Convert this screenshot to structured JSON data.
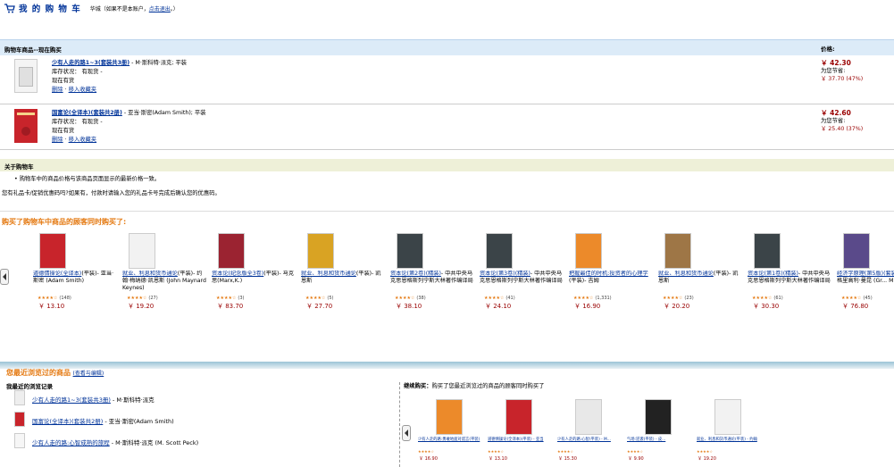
{
  "header": {
    "title": "我 的 购 物 车",
    "subtitle_pre": "华城（如果不是本账户，",
    "subtitle_link": "点击退出",
    "subtitle_post": "。）"
  },
  "cart": {
    "heading": "购物车商品--现在购买",
    "price_heading": "价格:",
    "items": [
      {
        "title": "少有人走的路1~3(套装共3册)",
        "author": " - M·斯科特·派克; 平装",
        "stock_label": "库存状况：",
        "stock_value": "有现货 -",
        "gift": "现在有货",
        "delete": "删除",
        "save": "移入收藏夹",
        "price": "￥ 42.30",
        "save_label": "为您节省:",
        "save_value": "￥ 37.70 (47%)"
      },
      {
        "title": "国富论(全译本)(套装共2册)",
        "author": " - 亚当·斯密(Adam Smith); 平装",
        "stock_label": "库存状况：",
        "stock_value": "有现货 -",
        "gift": "现在有货",
        "delete": "删除",
        "save": "移入收藏夹",
        "price": "￥ 42.60",
        "save_label": "为您节省:",
        "save_value": "￥ 25.40 (37%)"
      }
    ]
  },
  "about": {
    "heading": "关于购物车",
    "line1": "• 购物车中的商品价格与该商品页面显示的最新价格一致。",
    "line2": "您有礼品卡/促销优惠码吗?如果有，付款时请输入您的礼品卡号完成后确认您的优惠码。"
  },
  "also_bought": {
    "title": "购买了购物车中商品的顾客同时购买了:",
    "items": [
      {
        "title": "道德情操论(全译本)",
        "meta": "(平装)",
        "author": "- 亚当·斯密 (Adam Smith)",
        "reviews": "(148)",
        "price": "￥ 13.10",
        "color": "#c8242b"
      },
      {
        "title": "就业、利息和货币通论",
        "meta": "(平装)",
        "author": "- 约翰·梅纳德·凯恩斯 (John Maynard Keynes)",
        "reviews": "(27)",
        "price": "￥ 19.20",
        "color": "#f2f2f2"
      },
      {
        "title": "资本论(纪念版全3卷)",
        "meta": "(平装)",
        "author": "- 马克思(Marx,K.)",
        "reviews": "(3)",
        "price": "￥ 83.70",
        "color": "#9b2331"
      },
      {
        "title": "就业、利息和货币通论",
        "meta": "(平装)",
        "author": "- 凯恩斯",
        "reviews": "(5)",
        "price": "￥ 27.70",
        "color": "#d9a323"
      },
      {
        "title": "资本论(第2卷)(精装)",
        "meta": "",
        "author": "- 中共中央马克思恩格斯列宁斯大林著作编译局",
        "reviews": "(38)",
        "price": "￥ 38.10",
        "color": "#3b4448"
      },
      {
        "title": "资本论(第3卷)(精装)",
        "meta": "",
        "author": "- 中共中央马克思恩格斯列宁斯大林著作编译局",
        "reviews": "(41)",
        "price": "￥ 24.10",
        "color": "#3b4448"
      },
      {
        "title": "把握最佳的时机:投资者的心理学",
        "meta": "(平装)",
        "author": "- 吉姆",
        "reviews": "(1,331)",
        "price": "￥ 16.90",
        "color": "#ec8a2a"
      },
      {
        "title": "就业、利息和货币通论",
        "meta": "(平装)",
        "author": "- 凯恩斯",
        "reviews": "(23)",
        "price": "￥ 20.20",
        "color": "#9e7646"
      },
      {
        "title": "资本论(第1卷)(精装)",
        "meta": "",
        "author": "- 中共中央马克思恩格斯列宁斯大林著作编译局",
        "reviews": "(61)",
        "price": "￥ 30.30",
        "color": "#3b4448"
      },
      {
        "title": "经济学原理(第5版)(套装共2册)",
        "meta": "",
        "author": "- 格里高利·曼昆 (Gr... M...",
        "reviews": "(45)",
        "price": "￥ 76.80",
        "color": "#5a4a8a"
      }
    ]
  },
  "recent": {
    "title": "您最近浏览过的商品",
    "edit_link": "(查看与编辑)",
    "subtitle": "我最近的浏览记录",
    "items": [
      {
        "title": "少有人走的路1~3(套装共3册)",
        "author": " - M·斯科特·派克"
      },
      {
        "title": "国富论(全译本)(套装共2册)",
        "author": " - 亚当·斯密(Adam Smith)"
      },
      {
        "title": "少有人走的路:心智成熟的旅程",
        "author": " - M·斯科特·派克 (M. Scott Peck)"
      }
    ],
    "rec_label": "继续购买：",
    "rec_text": "购买了您最近浏览过的商品的顾客同时购买了",
    "rec_items": [
      {
        "title": "少有人走的路:勇敢地面对谎言",
        "meta": "(平装)",
        "price": "￥ 16.90",
        "color": "#ec8a2a"
      },
      {
        "title": "道德情操论(全译本)",
        "meta": "(平装) - 亚当",
        "price": "￥ 13.10",
        "color": "#c8242b"
      },
      {
        "title": "少有人走的路:心智",
        "meta": "(平装) - M...",
        "price": "￥ 15.30",
        "color": "#e8e8e8"
      },
      {
        "title": "气场:逆袭",
        "meta": "(平装) - 皮...",
        "price": "￥ 9.90",
        "color": "#222222"
      },
      {
        "title": "就业、利息和货币通论",
        "meta": "(平装) - 约翰",
        "price": "￥ 19.20",
        "color": "#f2f2f2"
      }
    ]
  }
}
